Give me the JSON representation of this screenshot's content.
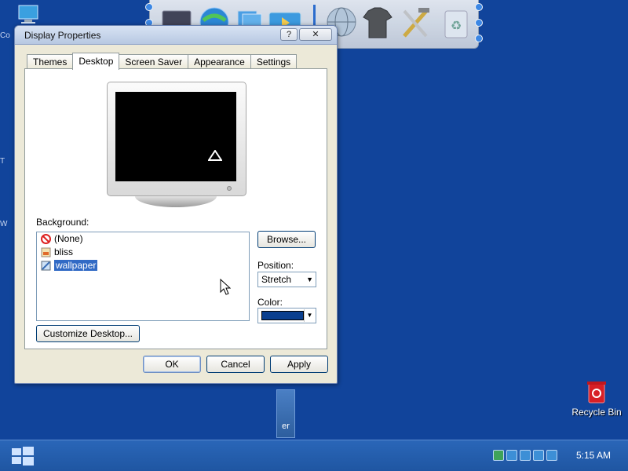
{
  "window": {
    "title": "Display Properties",
    "help_label": "?",
    "close_label": "✕"
  },
  "tabs": [
    {
      "label": "Themes"
    },
    {
      "label": "Desktop",
      "active": true
    },
    {
      "label": "Screen Saver"
    },
    {
      "label": "Appearance"
    },
    {
      "label": "Settings"
    }
  ],
  "desktop_tab": {
    "background_label": "Background:",
    "background_items": [
      {
        "label": "(None)",
        "icon": "none-icon"
      },
      {
        "label": "bliss",
        "icon": "image-file-icon"
      },
      {
        "label": "wallpaper",
        "icon": "image-file-icon",
        "selected": true
      }
    ],
    "browse_label": "Browse...",
    "position_label": "Position:",
    "position_value": "Stretch",
    "color_label": "Color:",
    "color_value": "#0a3f8f",
    "customize_label": "Customize Desktop..."
  },
  "footer": {
    "ok_label": "OK",
    "cancel_label": "Cancel",
    "apply_label": "Apply"
  },
  "desktop": {
    "recycle_bin_label": "Recycle Bin",
    "task_tile_label": "er",
    "clock": "5:15 AM",
    "sliver_labels": [
      "Co",
      "T",
      "W"
    ]
  },
  "colors": {
    "desktop_bg": "#11449b",
    "taskbar": "#1f56a2",
    "selection": "#316ac5"
  }
}
